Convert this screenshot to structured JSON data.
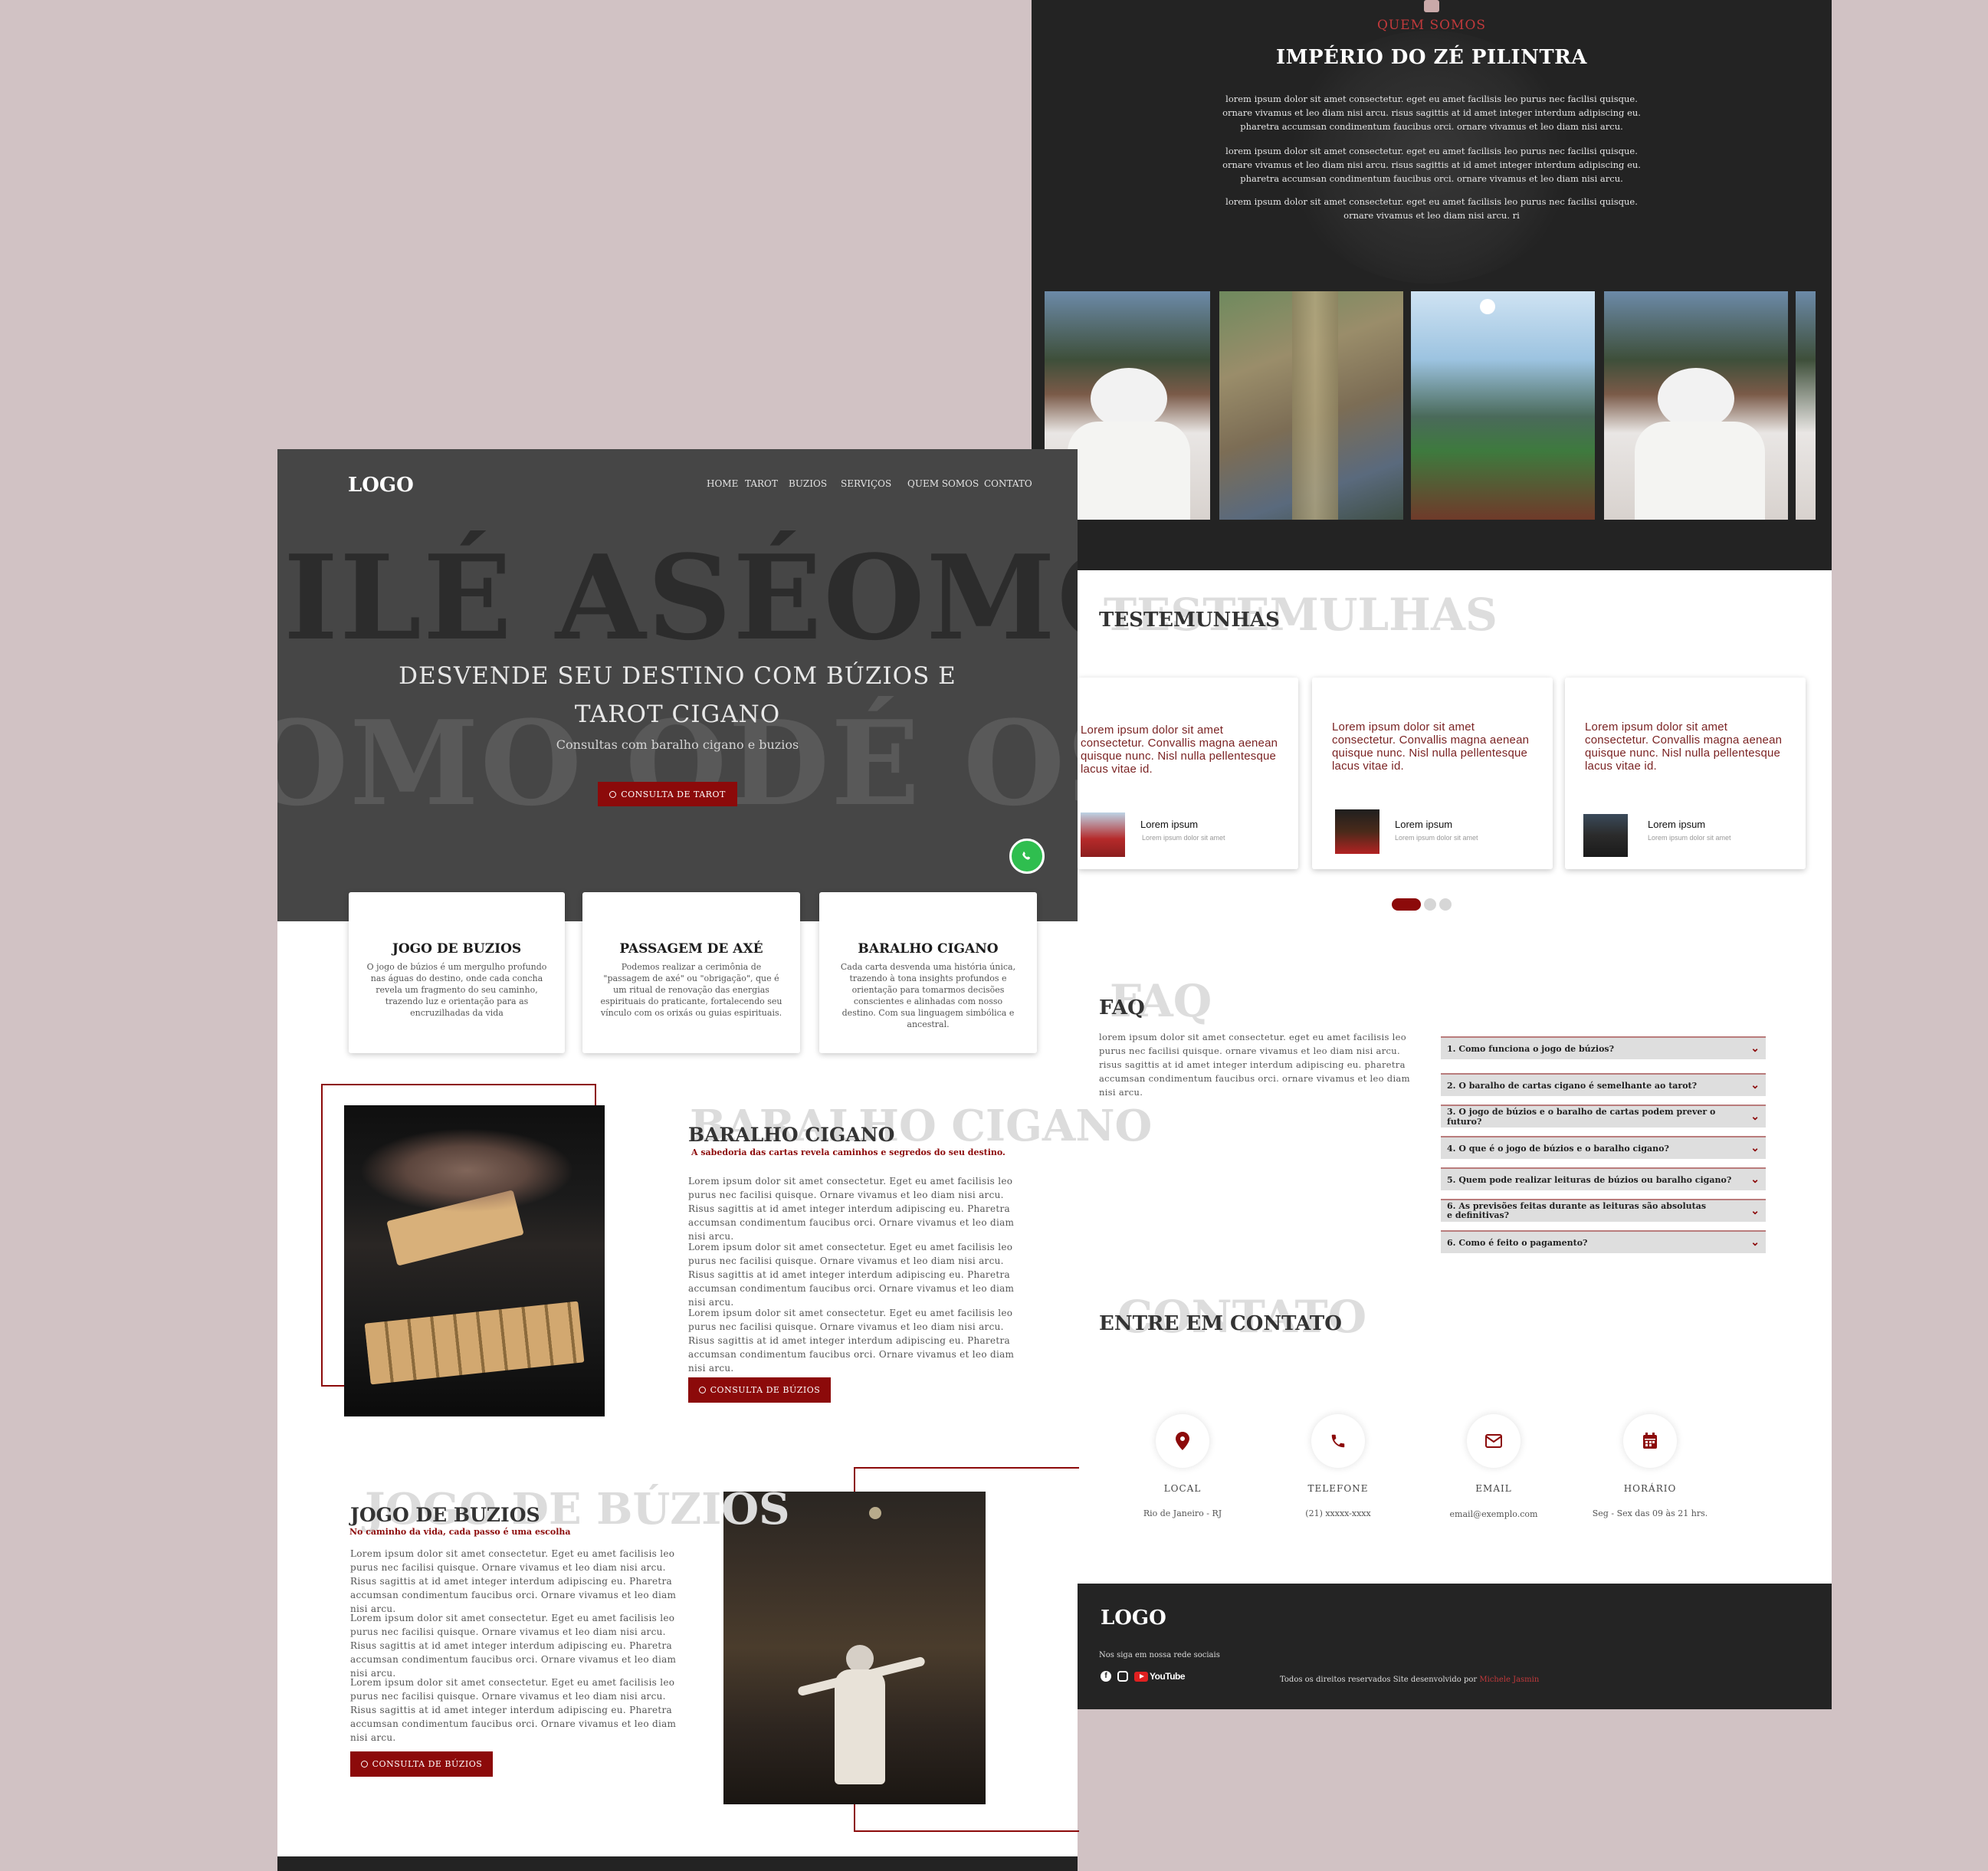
{
  "nav": {
    "logo": "LOGO",
    "links": [
      "HOME",
      "TAROT",
      "BUZIOS",
      "SERVIÇOS",
      "QUEM SOMOS",
      "CONTATO"
    ]
  },
  "hero": {
    "bg_line1": "ILÉ ASÉOMO O",
    "bg_line2": "OMO ODÉ OSU",
    "title_line1": "DESVENDE SEU DESTINO COM BÚZIOS E",
    "title_line2": "TAROT CIGANO",
    "subtitle": "Consultas com baralho cigano e buzios",
    "cta": "CONSULTA DE TAROT"
  },
  "services": [
    {
      "title": "JOGO DE BUZIOS",
      "text": "O jogo de búzios é um mergulho profundo nas águas do destino, onde cada concha revela um fragmento do seu caminho, trazendo luz e orientação para as encruzilhadas da vida"
    },
    {
      "title": "PASSAGEM DE AXÉ",
      "text": "Podemos realizar a cerimônia de \"passagem de axé\" ou \"obrigação\", que é um ritual de renovação das energias espirituais do praticante, fortalecendo seu vínculo com os orixás ou guias espirituais."
    },
    {
      "title": "BARALHO CIGANO",
      "text": "Cada carta desvenda uma história única, trazendo à tona insights profundos e orientação para tomarmos decisões conscientes e alinhadas com nosso destino. Com sua linguagem simbólica e ancestral."
    }
  ],
  "baralho": {
    "ghost": "BARALHO CIGANO",
    "title": "BARALHO CIGANO",
    "subtitle": "A sabedoria das cartas revela caminhos e segredos do seu destino.",
    "paragraphs": [
      "Lorem ipsum dolor sit amet consectetur. Eget eu amet facilisis leo purus nec facilisi quisque. Ornare vivamus et leo diam nisi arcu. Risus sagittis at id amet integer interdum adipiscing eu. Pharetra accumsan condimentum faucibus orci. Ornare vivamus et leo diam nisi arcu.",
      "Lorem ipsum dolor sit amet consectetur. Eget eu amet facilisis leo purus nec facilisi quisque. Ornare vivamus et leo diam nisi arcu. Risus sagittis at id amet integer interdum adipiscing eu. Pharetra accumsan condimentum faucibus orci. Ornare vivamus et leo diam nisi arcu.",
      "Lorem ipsum dolor sit amet consectetur. Eget eu amet facilisis leo purus nec facilisi quisque. Ornare vivamus et leo diam nisi arcu. Risus sagittis at id amet integer interdum adipiscing eu. Pharetra accumsan condimentum faucibus orci. Ornare vivamus et leo diam nisi arcu."
    ],
    "cta": "CONSULTA DE BÚZIOS"
  },
  "buzios": {
    "ghost": "JOGO DE BÚZIOS",
    "title": "JOGO DE BUZIOS",
    "subtitle": "No caminho da vida, cada passo é uma escolha",
    "paragraphs": [
      "Lorem ipsum dolor sit amet consectetur. Eget eu amet facilisis leo purus nec facilisi quisque. Ornare vivamus et leo diam nisi arcu. Risus sagittis at id amet integer interdum adipiscing eu. Pharetra accumsan condimentum faucibus orci. Ornare vivamus et leo diam nisi arcu.",
      "Lorem ipsum dolor sit amet consectetur. Eget eu amet facilisis leo purus nec facilisi quisque. Ornare vivamus et leo diam nisi arcu. Risus sagittis at id amet integer interdum adipiscing eu. Pharetra accumsan condimentum faucibus orci. Ornare vivamus et leo diam nisi arcu.",
      "Lorem ipsum dolor sit amet consectetur. Eget eu amet facilisis leo purus nec facilisi quisque. Ornare vivamus et leo diam nisi arcu. Risus sagittis at id amet integer interdum adipiscing eu. Pharetra accumsan condimentum faucibus orci. Ornare vivamus et leo diam nisi arcu."
    ],
    "cta": "CONSULTA DE BÚZIOS"
  },
  "about": {
    "kicker": "QUEM SOMOS",
    "title": "IMPÉRIO DO ZÉ PILINTRA",
    "paragraphs": [
      "lorem ipsum dolor sit amet consectetur. eget eu amet facilisis leo purus nec facilisi quisque. ornare vivamus et leo diam nisi arcu. risus sagittis at id amet integer interdum adipiscing eu. pharetra accumsan condimentum faucibus orci. ornare vivamus et leo diam nisi arcu.",
      "lorem ipsum dolor sit amet consectetur. eget eu amet facilisis leo purus nec facilisi quisque. ornare vivamus et leo diam nisi arcu. risus sagittis at id amet integer interdum adipiscing eu. pharetra accumsan condimentum faucibus orci. ornare vivamus et leo diam nisi arcu.",
      "lorem ipsum dolor sit amet consectetur. eget eu amet facilisis leo purus nec facilisi quisque. ornare vivamus et leo diam nisi arcu. ri"
    ]
  },
  "testimonials": {
    "ghost": "TESTEMULHAS",
    "title": "TESTEMUNHAS",
    "items": [
      {
        "text": "Lorem ipsum dolor sit amet consectetur. Convallis magna aenean quisque nunc. Nisl nulla pellentesque lacus vitae id.",
        "name": "Lorem  ipsum",
        "role": "Lorem ipsum dolor sit amet"
      },
      {
        "text": "Lorem ipsum dolor sit amet consectetur. Convallis magna aenean quisque nunc. Nisl nulla pellentesque lacus vitae id.",
        "name": "Lorem  ipsum",
        "role": "Lorem ipsum dolor sit amet"
      },
      {
        "text": "Lorem ipsum dolor sit amet consectetur. Convallis magna aenean quisque nunc. Nisl nulla pellentesque lacus vitae id.",
        "name": "Lorem  ipsum",
        "role": "Lorem ipsum dolor sit amet"
      }
    ]
  },
  "faq": {
    "ghost": "FAQ",
    "title": "FAQ",
    "intro": "lorem ipsum dolor sit amet consectetur. eget eu amet facilisis leo purus nec facilisi quisque. ornare vivamus et leo diam nisi arcu. risus sagittis at id amet integer interdum adipiscing eu. pharetra accumsan condimentum faucibus orci. ornare vivamus et leo diam nisi arcu.",
    "questions": [
      "1.  Como funciona o jogo de búzios?",
      "2.  O baralho de cartas cigano é semelhante ao tarot?",
      "3.  O jogo de búzios e o baralho de cartas podem prever o futuro?",
      "4.  O que é o jogo de búzios e o baralho cigano?",
      "5.  Quem pode realizar leituras de búzios ou baralho cigano?",
      "6.  As previsões feitas durante as leituras são absolutas e definitivas?",
      "6.  Como é feito o pagamento?"
    ]
  },
  "contact": {
    "ghost": "CONTATO",
    "title": "ENTRE EM CONTATO",
    "items": [
      {
        "label": "LOCAL",
        "value": "Rio de Janeiro - RJ",
        "icon": "map-pin-icon"
      },
      {
        "label": "TELEFONE",
        "value": "(21) xxxxx-xxxx",
        "icon": "phone-icon"
      },
      {
        "label": "EMAIL",
        "value": "email@exemplo.com",
        "icon": "mail-icon"
      },
      {
        "label": "HORÁRIO",
        "value": "Seg - Sex das 09 às 21 hrs.",
        "icon": "calendar-icon"
      }
    ]
  },
  "footer": {
    "logo": "LOGO",
    "follow": "Nos siga em nossa rede sociais",
    "youtube": "YouTube",
    "rights": "Todos os direitos reservados   Site desenvolvido  por",
    "author": "Michele Jasmin"
  },
  "colors": {
    "accent": "#8c0a0a",
    "page_bg": "#d1c2c4",
    "dark": "#232323",
    "hero": "#464646"
  }
}
